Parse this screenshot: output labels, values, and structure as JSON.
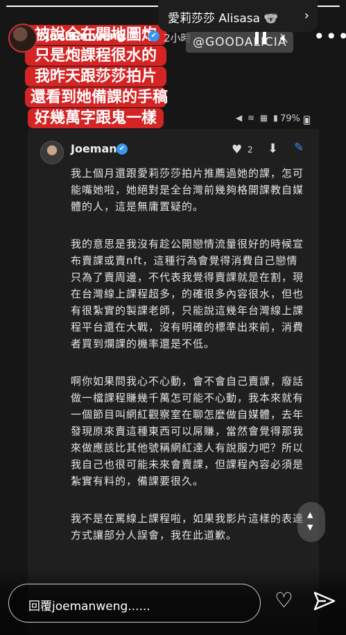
{
  "story": {
    "progress": 1.0,
    "header": {
      "username": "joemanweng",
      "verified_mark": "✔",
      "time": "2小時",
      "mention": "@GOODALICIA",
      "more_label": "•••"
    },
    "music": {
      "label": "愛莉莎莎 Alisasa 🐨",
      "chevron": "›"
    },
    "caption": {
      "lines": [
        "被說全在開地圖炮",
        "只是炮課程很水的",
        "我昨天跟莎莎拍片",
        "還看到她備課的手稿",
        "好幾萬字跟鬼一樣"
      ]
    },
    "screenshot": {
      "status_icons": "◀ ≋ ▦ ▮",
      "battery_pct": "79%",
      "tweet": {
        "author": "Joeman",
        "verified_mark": "✔",
        "likes": "2",
        "paragraphs": [
          "我上個月還跟愛莉莎莎拍片推薦過她的課，怎可能嘴她啦，她絕對是全台灣前幾夠格開課教自媒體的人，這是無庸置疑的。",
          "我的意思是我沒有趁公開戀情流量很好的時候宣布賣課或賣nft，這種行為會覺得消費自己戀情只為了賣周邊，不代表我覺得賣課就是在割，現在台灣線上課程超多，的確很多內容很水，但也有很紮實的製課老師，只能說這幾年台灣線上課程平台還在大戰，沒有明確的標準出來前，消費者買到爛課的機率還是不低。",
          "啊你如果問我心不心動，會不會自己賣課，廢話做一檔課程賺幾千萬怎可能不心動，我本來就有一個節目叫網紅觀察室在聊怎麼做自媒體，去年發現原來賣這種東西可以屌賺，當然會覺得那我來做應該比其他號稱網紅達人有說服力吧？所以我自己也很可能未來會賣課，但課程內容必須是紮實有料的，備課要很久。",
          "我不是在罵線上課程啦，如果我影片這樣的表達方式讓部分人誤會，我在此道歉。"
        ]
      }
    },
    "scroll": {
      "up": "▲",
      "down": "▼"
    },
    "reply": {
      "placeholder": "回覆joemanweng......",
      "heart_icon": "♡"
    }
  }
}
